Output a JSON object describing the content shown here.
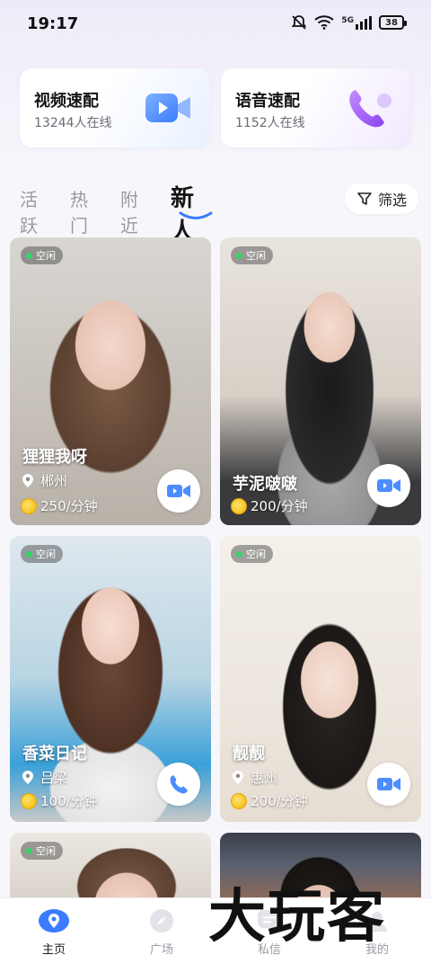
{
  "status_bar": {
    "time": "19:17",
    "network": "5G",
    "battery": "38"
  },
  "quick_match": [
    {
      "title": "视频速配",
      "online": "13244人在线",
      "icon": "video-camera-icon",
      "accent": "#4b8dff"
    },
    {
      "title": "语音速配",
      "online": "1152人在线",
      "icon": "phone-icon",
      "accent": "#9a58f5"
    }
  ],
  "tabs": [
    {
      "label": "活跃",
      "active": false
    },
    {
      "label": "热门",
      "active": false
    },
    {
      "label": "附近",
      "active": false
    },
    {
      "label": "新人",
      "active": true
    }
  ],
  "filter": {
    "label": "筛选"
  },
  "cards": [
    {
      "status": "空闲",
      "name": "狸狸我呀",
      "location": "郴州",
      "price": "250/分钟",
      "call": "video"
    },
    {
      "status": "空闲",
      "name": "芋泥啵啵",
      "location": "",
      "price": "200/分钟",
      "call": "video"
    },
    {
      "status": "空闲",
      "name": "香菜日记",
      "location": "吕梁",
      "price": "100/分钟",
      "call": "voice"
    },
    {
      "status": "空闲",
      "name": "靓靓",
      "location": "惠州",
      "price": "200/分钟",
      "call": "video"
    },
    {
      "status": "空闲"
    },
    {
      "status": ""
    }
  ],
  "bottom_nav": [
    {
      "label": "主页",
      "active": true
    },
    {
      "label": "广场",
      "active": false
    },
    {
      "label": "私信",
      "active": false
    },
    {
      "label": "我的",
      "active": false
    }
  ],
  "watermark": "大玩客",
  "colors": {
    "accent_blue": "#4b8dff",
    "online_dot": "#35d46a",
    "coin": "#f2b400"
  }
}
